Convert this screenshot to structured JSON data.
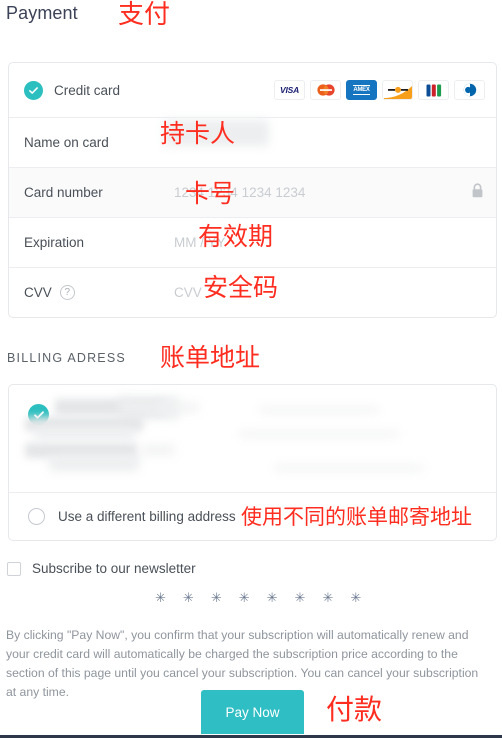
{
  "page": {
    "title": "Payment",
    "title_annotation": "支付"
  },
  "colors": {
    "accent_teal": "#2bbfbf",
    "button_teal": "#2ebec4",
    "annotation_red": "#ff2d1f",
    "label_text": "#4a5058",
    "placeholder_text": "#c9ccd1",
    "panel_border": "#e6e8eb",
    "shaded_row": "#fafafa"
  },
  "credit_card_panel": {
    "method_label": "Credit card",
    "method_selected": true,
    "brands": [
      {
        "name": "visa-logo",
        "text": "VISA"
      },
      {
        "name": "mastercard-logo",
        "text": ""
      },
      {
        "name": "amex-logo",
        "text": "AMEX"
      },
      {
        "name": "discover-logo",
        "text": ""
      },
      {
        "name": "jcb-logo",
        "text": ""
      },
      {
        "name": "diners-club-logo",
        "text": ""
      }
    ],
    "fields": [
      {
        "label": "Name on card",
        "value": "",
        "placeholder": "",
        "annotation": "持卡人",
        "shaded": false,
        "trailing_icon": ""
      },
      {
        "label": "Card number",
        "value": "",
        "placeholder": "1234 1234 1234 1234",
        "annotation": "卡号",
        "shaded": true,
        "trailing_icon": "lock-icon"
      },
      {
        "label": "Expiration",
        "value": "",
        "placeholder": "MM / YY",
        "annotation": "有效期",
        "shaded": false,
        "trailing_icon": ""
      },
      {
        "label": "CVV",
        "value": "",
        "placeholder": "CVV",
        "annotation": "安全码",
        "shaded": false,
        "trailing_icon": "help-icon",
        "help_glyph": "?"
      }
    ]
  },
  "billing": {
    "section_label": "BILLING ADRESS",
    "section_annotation": "账单地址",
    "selected_address_redacted": true,
    "alternative_label": "Use a different billing address",
    "alternative_annotation": "使用不同的账单邮寄地址",
    "alternative_selected": false
  },
  "newsletter": {
    "label": "Subscribe to our newsletter",
    "checked": false
  },
  "stars": {
    "glyph": "✳",
    "count": 8
  },
  "legal": {
    "text": "By clicking \"Pay Now\", you confirm that your subscription will automatically renew and your credit card will automatically be charged the subscription price according to the section of this page until you cancel your subscription. You can cancel your subscription at any time."
  },
  "pay": {
    "button_label": "Pay Now",
    "button_annotation": "付款"
  }
}
